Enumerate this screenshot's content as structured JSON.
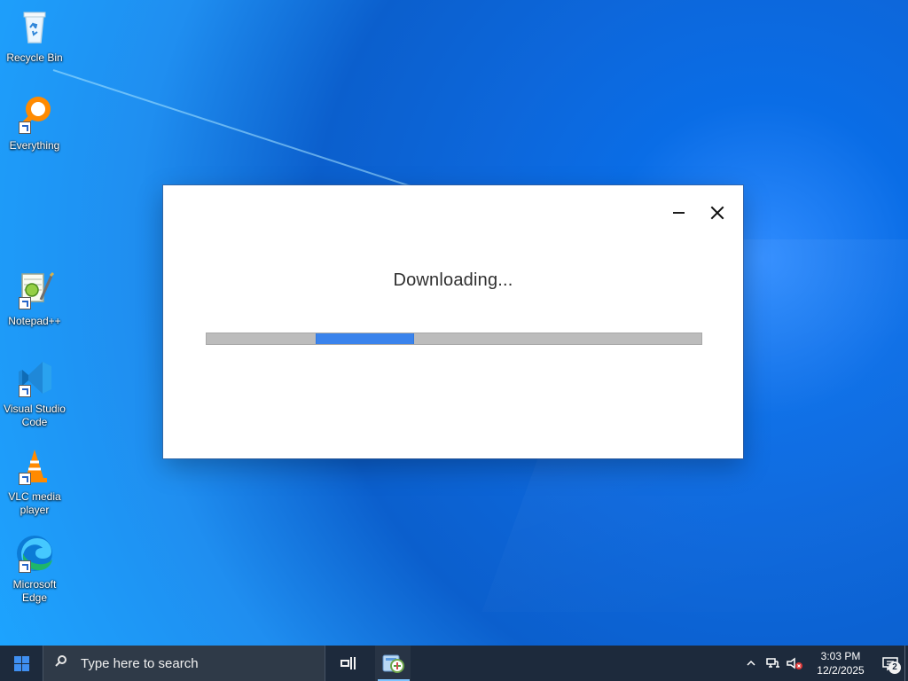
{
  "desktop": {
    "icons": [
      {
        "label": "Recycle Bin"
      },
      {
        "label": "Everything"
      },
      {
        "label": "Notepad++"
      },
      {
        "label": "Visual Studio\nCode"
      },
      {
        "label": "VLC media\nplayer"
      },
      {
        "label": "Microsoft\nEdge"
      }
    ]
  },
  "dialog": {
    "status_text": "Downloading...",
    "progress": {
      "segment_start_percent": 22,
      "segment_end_percent": 42
    },
    "colors": {
      "progress_fill": "#3a83ec",
      "progress_track": "#bcbcbc"
    }
  },
  "taskbar": {
    "search_placeholder": "Type here to search",
    "clock_time": "3:03 PM",
    "clock_date": "12/2/2025",
    "notification_count": "2"
  },
  "icons": {
    "start": "windows-logo-icon",
    "search": "search-icon",
    "task_view": "task-view-icon",
    "active_app": "installer-app-icon",
    "tray_chevron": "chevron-up-icon",
    "network": "network-icon",
    "volume": "volume-muted-icon",
    "notifications": "notification-icon",
    "minimize": "minimize-icon",
    "close": "close-icon"
  }
}
